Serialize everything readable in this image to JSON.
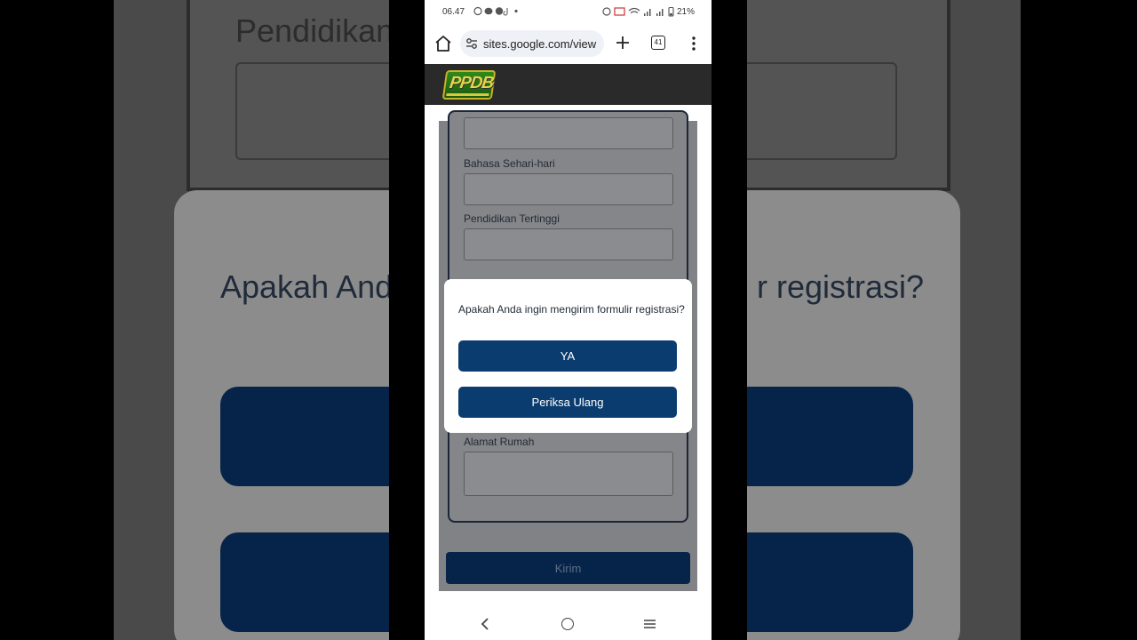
{
  "background": {
    "frame_text": "Pendidikan",
    "question_left": "Apakah And",
    "question_right": "r registrasi?"
  },
  "status_bar": {
    "time": "06.47",
    "battery": "21%",
    "left_icons": "whatsapp-icon chat-icon messenger-icon tiktok-icon dot-icon",
    "right_icons": "alarm-icon cast-icon wifi-icon signal-icon battery-icon"
  },
  "browser": {
    "url": "sites.google.com/view",
    "tab_count": "41"
  },
  "site": {
    "logo_text": "PPDB"
  },
  "form": {
    "fields": [
      {
        "label": "Bahasa Sehari-hari"
      },
      {
        "label": "Pendidikan Tertinggi"
      },
      {
        "label": "Alamat Rumah"
      }
    ],
    "submit_label": "Kirim"
  },
  "dialog": {
    "message": "Apakah Anda ingin mengirim formulir registrasi?",
    "confirm_label": "YA",
    "review_label": "Periksa Ulang"
  },
  "colors": {
    "primary": "#0b3c6f",
    "primary_dark": "#06244a",
    "overlay": "#808285"
  }
}
